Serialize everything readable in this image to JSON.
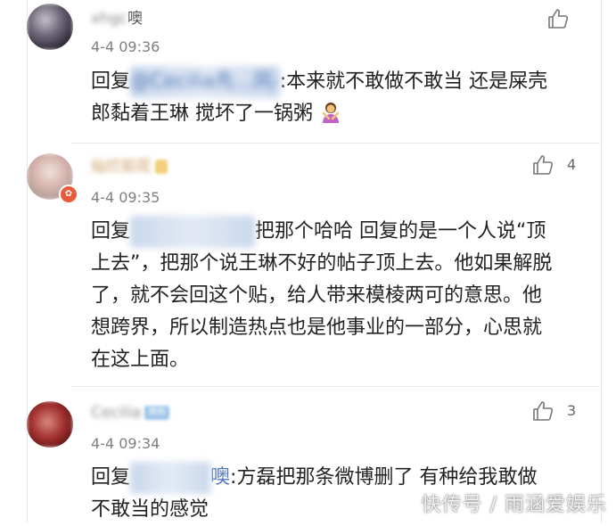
{
  "comments": [
    {
      "username_visible": "xhgc",
      "username_suffix": "噢",
      "timestamp": "4-4 09:36",
      "reply_prefix": "回复",
      "mention": "@Cecilia先...风-",
      "text": ":本来就不敢做不敢当 还是屎壳郎黏着王琳 搅坏了一锅粥",
      "emoji": "person-gesturing-no-icon",
      "likes": ""
    },
    {
      "username_visible": "灿烂如花",
      "tag": "",
      "timestamp": "4-4 09:35",
      "reply_prefix": "回复",
      "mention": "@...",
      "text": "把那个哈哈 回复的是一个人说“顶上去”，把那个说王琳不好的帖子顶上去。他如果解脱了，就不会回这个贴，给人带来模棱两可的意思。他想跨界，所以制造热点也是他事业的一部分，心思就在这上面。",
      "likes": "4"
    },
    {
      "username_visible": "Cecilia",
      "tag": "铁粉",
      "timestamp": "4-4 09:34",
      "reply_prefix": "回复",
      "mention": "@...",
      "mention_suffix": "噢",
      "text": ":方磊把那条微博删了 有种给我敢做不敢当的感觉",
      "likes": "3"
    }
  ],
  "watermark": "快传号 / 雨涵爱娱乐",
  "colors": {
    "mention": "#5177b8",
    "text": "#222222",
    "meta": "#808080"
  }
}
